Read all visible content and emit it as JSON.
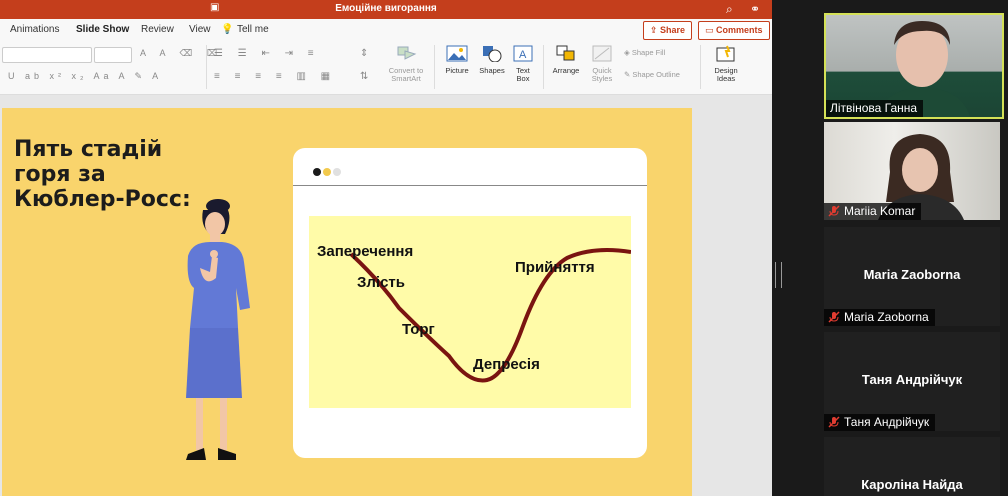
{
  "window": {
    "title": "Емоційне вигорання"
  },
  "ribbon": {
    "tabs": [
      "Animations",
      "Slide Show",
      "Review",
      "View"
    ],
    "tell_me": "Tell me",
    "share_label": "Share",
    "comments_label": "Comments"
  },
  "toolbar": {
    "convert_smartart": "Convert to\nSmartArt",
    "picture": "Picture",
    "shapes": "Shapes",
    "text_box": "Text\nBox",
    "arrange": "Arrange",
    "quick_styles": "Quick\nStyles",
    "shape_fill": "Shape Fill",
    "shape_outline": "Shape Outline",
    "design_ideas": "Design\nIdeas"
  },
  "slide": {
    "title": "Пять стадій\nгоря за\nКюблер-Росс:",
    "stages": [
      "Заперечення",
      "Злість",
      "Торг",
      "Депресія",
      "Прийняття"
    ],
    "colors": {
      "background": "#f9d46c",
      "diagram": "#fffba8",
      "curve": "#7a1410",
      "accent": "#c43e1c"
    }
  },
  "participants": [
    {
      "name": "Літвінова Ганна",
      "video": true,
      "speaking": true,
      "muted": false
    },
    {
      "name": "Mariia Komar",
      "video": true,
      "speaking": false,
      "muted": true
    },
    {
      "name": "Maria Zaoborna",
      "video": false,
      "speaking": false,
      "muted": true
    },
    {
      "name": "Таня Андрійчук",
      "video": false,
      "speaking": false,
      "muted": true
    },
    {
      "name": "Кароліна Найда",
      "video": false,
      "speaking": false,
      "muted": false
    }
  ],
  "icons": [
    "search-icon",
    "share-icon",
    "lightbulb-icon",
    "mic-muted-icon"
  ]
}
